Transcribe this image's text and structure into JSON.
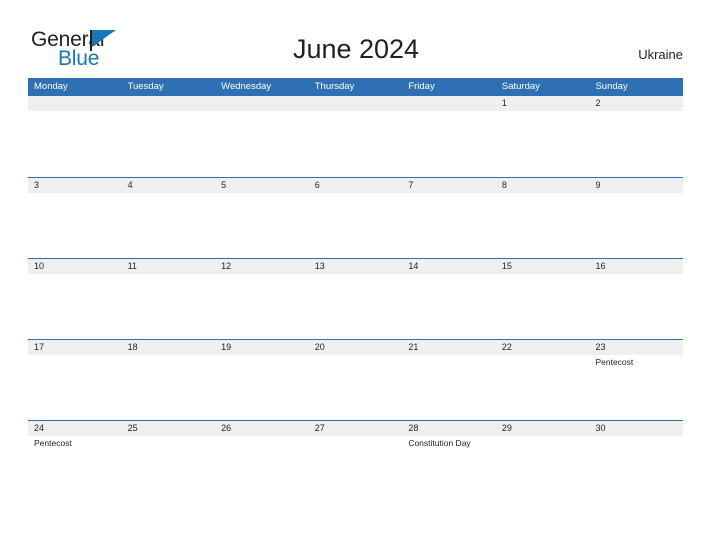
{
  "brand": {
    "name_part1": "General",
    "name_part2": "Blue",
    "flag_icon": "flag-triangle-icon"
  },
  "header": {
    "title": "June 2024",
    "country": "Ukraine"
  },
  "calendar": {
    "month": "June",
    "year": "2024",
    "weekday_headers": [
      "Monday",
      "Tuesday",
      "Wednesday",
      "Thursday",
      "Friday",
      "Saturday",
      "Sunday"
    ],
    "weeks": [
      [
        {
          "date": "",
          "events": []
        },
        {
          "date": "",
          "events": []
        },
        {
          "date": "",
          "events": []
        },
        {
          "date": "",
          "events": []
        },
        {
          "date": "",
          "events": []
        },
        {
          "date": "1",
          "events": []
        },
        {
          "date": "2",
          "events": []
        }
      ],
      [
        {
          "date": "3",
          "events": []
        },
        {
          "date": "4",
          "events": []
        },
        {
          "date": "5",
          "events": []
        },
        {
          "date": "6",
          "events": []
        },
        {
          "date": "7",
          "events": []
        },
        {
          "date": "8",
          "events": []
        },
        {
          "date": "9",
          "events": []
        }
      ],
      [
        {
          "date": "10",
          "events": []
        },
        {
          "date": "11",
          "events": []
        },
        {
          "date": "12",
          "events": []
        },
        {
          "date": "13",
          "events": []
        },
        {
          "date": "14",
          "events": []
        },
        {
          "date": "15",
          "events": []
        },
        {
          "date": "16",
          "events": []
        }
      ],
      [
        {
          "date": "17",
          "events": []
        },
        {
          "date": "18",
          "events": []
        },
        {
          "date": "19",
          "events": []
        },
        {
          "date": "20",
          "events": []
        },
        {
          "date": "21",
          "events": []
        },
        {
          "date": "22",
          "events": []
        },
        {
          "date": "23",
          "events": [
            "Pentecost"
          ]
        }
      ],
      [
        {
          "date": "24",
          "events": [
            "Pentecost"
          ]
        },
        {
          "date": "25",
          "events": []
        },
        {
          "date": "26",
          "events": []
        },
        {
          "date": "27",
          "events": []
        },
        {
          "date": "28",
          "events": [
            "Constitution Day"
          ]
        },
        {
          "date": "29",
          "events": []
        },
        {
          "date": "30",
          "events": []
        }
      ]
    ]
  },
  "colors": {
    "header_blue": "#2e70b3",
    "band_gray": "#efeff0",
    "brand_blue": "#1b75bb",
    "text_dark": "#231f20",
    "page_background": "#ffffff"
  }
}
